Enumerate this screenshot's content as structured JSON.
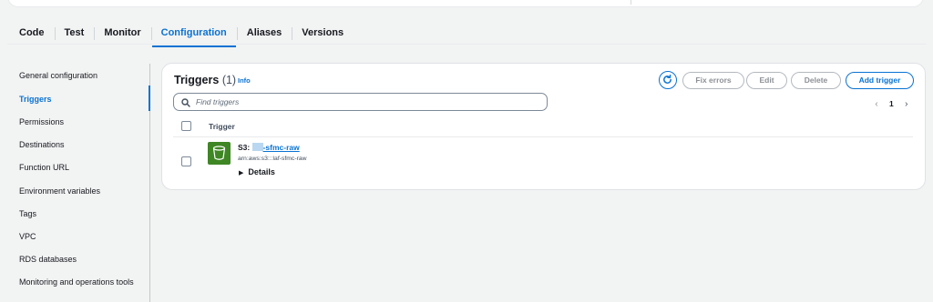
{
  "tabs": [
    {
      "label": "Code"
    },
    {
      "label": "Test"
    },
    {
      "label": "Monitor"
    },
    {
      "label": "Configuration",
      "active": true
    },
    {
      "label": "Aliases"
    },
    {
      "label": "Versions"
    }
  ],
  "sidebar": {
    "items": [
      {
        "label": "General configuration"
      },
      {
        "label": "Triggers",
        "active": true
      },
      {
        "label": "Permissions"
      },
      {
        "label": "Destinations"
      },
      {
        "label": "Function URL"
      },
      {
        "label": "Environment variables"
      },
      {
        "label": "Tags"
      },
      {
        "label": "VPC"
      },
      {
        "label": "RDS databases"
      },
      {
        "label": "Monitoring and operations tools"
      }
    ]
  },
  "triggers_panel": {
    "title": "Triggers",
    "count": "(1)",
    "info_label": "Info",
    "refresh_icon": "refresh-icon",
    "buttons": {
      "fix_errors": "Fix errors",
      "edit": "Edit",
      "delete": "Delete",
      "add_trigger": "Add trigger"
    },
    "search": {
      "placeholder": "Find triggers",
      "value": "",
      "icon": "search-icon"
    },
    "pagination": {
      "prev": "‹",
      "page": "1",
      "next": "›"
    },
    "table": {
      "column_header": "Trigger",
      "rows": [
        {
          "service_icon": "s3-bucket-icon",
          "name_prefix": "S3: ",
          "name_suffix": "-sfmc-raw",
          "arn": "arn:aws:s3:::laf-sfmc-raw",
          "details_label": "Details"
        }
      ]
    }
  },
  "colors": {
    "accent": "#0972d3",
    "s3_green": "#3f8624",
    "background": "#f2f3f3"
  }
}
